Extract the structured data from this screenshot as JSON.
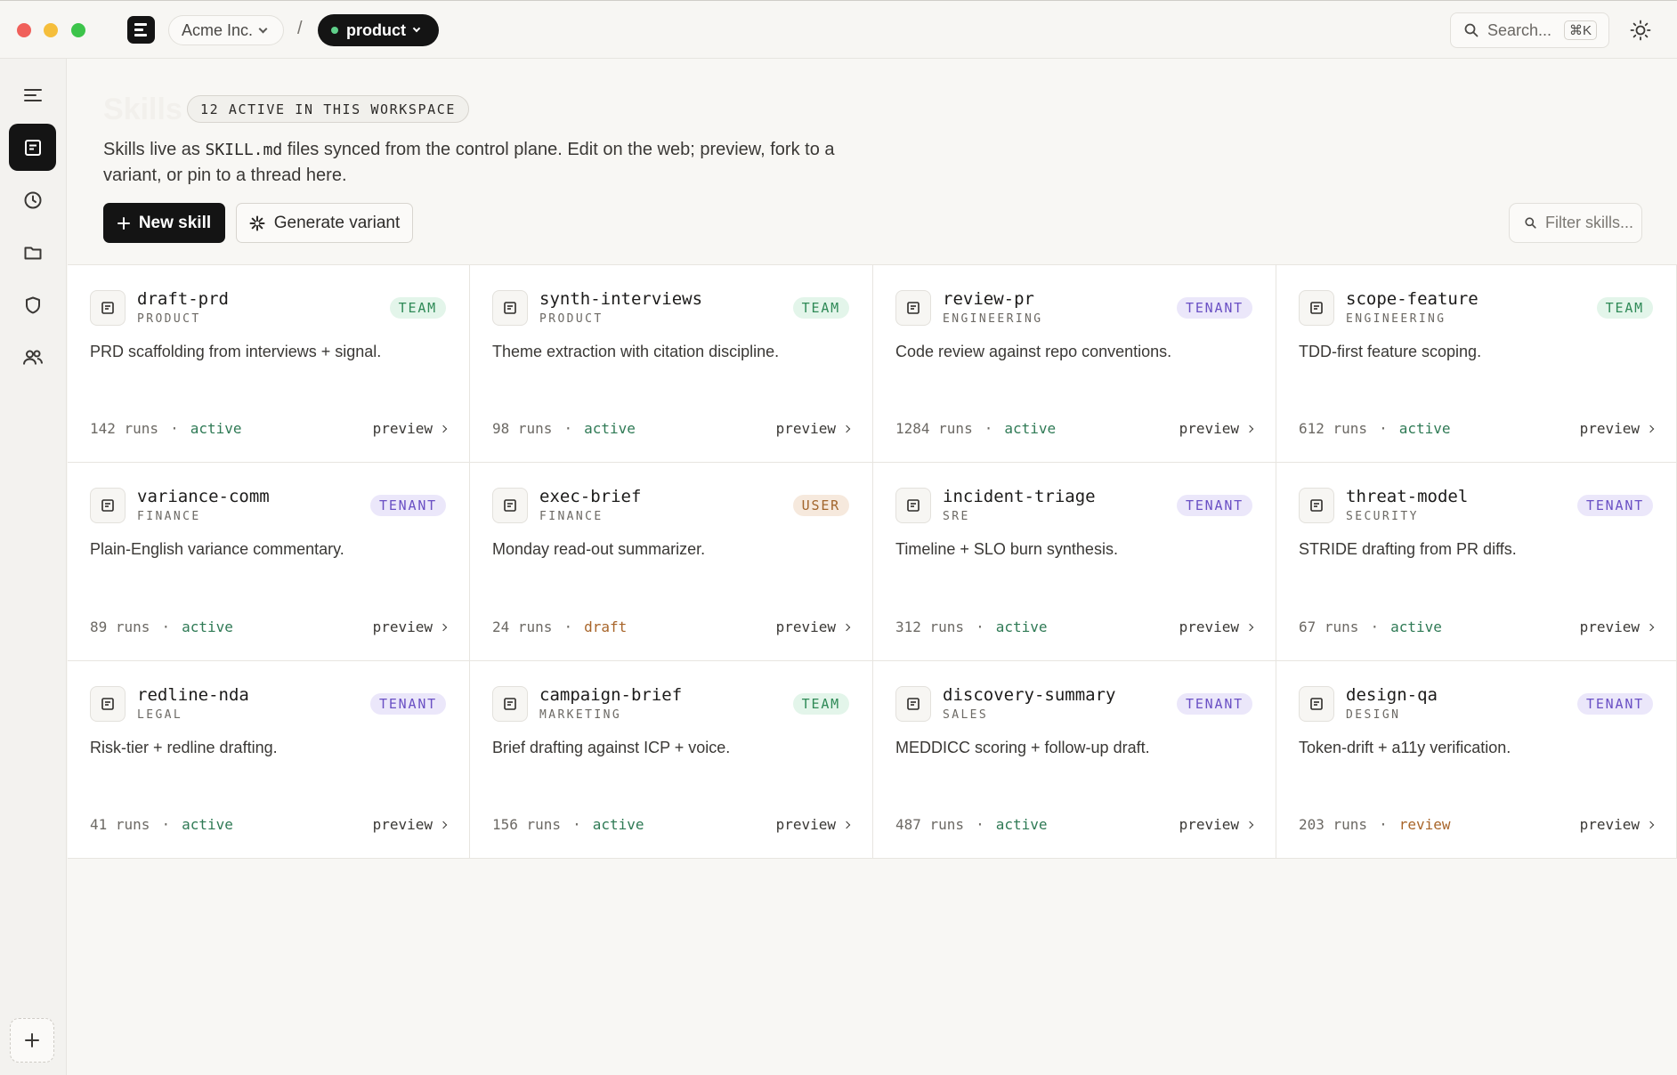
{
  "titlebar": {
    "org_name": "Acme Inc.",
    "breadcrumb_sep": "/",
    "project_name": "product",
    "search_placeholder": "Search...",
    "search_shortcut": "⌘K"
  },
  "page": {
    "title": "Skills",
    "count_badge": "12 ACTIVE IN THIS WORKSPACE",
    "desc_before": "Skills live as ",
    "desc_code": "SKILL.md",
    "desc_after": " files synced from the control plane. Edit on the web; preview, fork to a variant, or pin to a thread here.",
    "new_skill_label": "New skill",
    "generate_variant_label": "Generate variant",
    "filter_placeholder": "Filter skills..."
  },
  "skills": [
    {
      "name": "draft-prd",
      "category": "PRODUCT",
      "scope": "TEAM",
      "description": "PRD scaffolding from interviews + signal.",
      "runs": "142 runs",
      "status": "active",
      "preview": "preview"
    },
    {
      "name": "synth-interviews",
      "category": "PRODUCT",
      "scope": "TEAM",
      "description": "Theme extraction with citation discipline.",
      "runs": "98 runs",
      "status": "active",
      "preview": "preview"
    },
    {
      "name": "review-pr",
      "category": "ENGINEERING",
      "scope": "TENANT",
      "description": "Code review against repo conventions.",
      "runs": "1284 runs",
      "status": "active",
      "preview": "preview"
    },
    {
      "name": "scope-feature",
      "category": "ENGINEERING",
      "scope": "TEAM",
      "description": "TDD-first feature scoping.",
      "runs": "612 runs",
      "status": "active",
      "preview": "preview"
    },
    {
      "name": "variance-comm",
      "category": "FINANCE",
      "scope": "TENANT",
      "description": "Plain-English variance commentary.",
      "runs": "89 runs",
      "status": "active",
      "preview": "preview"
    },
    {
      "name": "exec-brief",
      "category": "FINANCE",
      "scope": "USER",
      "description": "Monday read-out summarizer.",
      "runs": "24 runs",
      "status": "draft",
      "preview": "preview"
    },
    {
      "name": "incident-triage",
      "category": "SRE",
      "scope": "TENANT",
      "description": "Timeline + SLO burn synthesis.",
      "runs": "312 runs",
      "status": "active",
      "preview": "preview"
    },
    {
      "name": "threat-model",
      "category": "SECURITY",
      "scope": "TENANT",
      "description": "STRIDE drafting from PR diffs.",
      "runs": "67 runs",
      "status": "active",
      "preview": "preview"
    },
    {
      "name": "redline-nda",
      "category": "LEGAL",
      "scope": "TENANT",
      "description": "Risk-tier + redline drafting.",
      "runs": "41 runs",
      "status": "active",
      "preview": "preview"
    },
    {
      "name": "campaign-brief",
      "category": "MARKETING",
      "scope": "TEAM",
      "description": "Brief drafting against ICP + voice.",
      "runs": "156 runs",
      "status": "active",
      "preview": "preview"
    },
    {
      "name": "discovery-summary",
      "category": "SALES",
      "scope": "TENANT",
      "description": "MEDDICC scoring + follow-up draft.",
      "runs": "487 runs",
      "status": "active",
      "preview": "preview"
    },
    {
      "name": "design-qa",
      "category": "DESIGN",
      "scope": "TENANT",
      "description": "Token-drift + a11y verification.",
      "runs": "203 runs",
      "status": "review",
      "preview": "preview"
    }
  ],
  "footer_sep": "·",
  "colors": {
    "accent_dark": "#141414",
    "team": "#2f8a57",
    "tenant": "#6a50c4",
    "user": "#a2652c",
    "active": "#2f7a55",
    "draft": "#a8652a"
  }
}
